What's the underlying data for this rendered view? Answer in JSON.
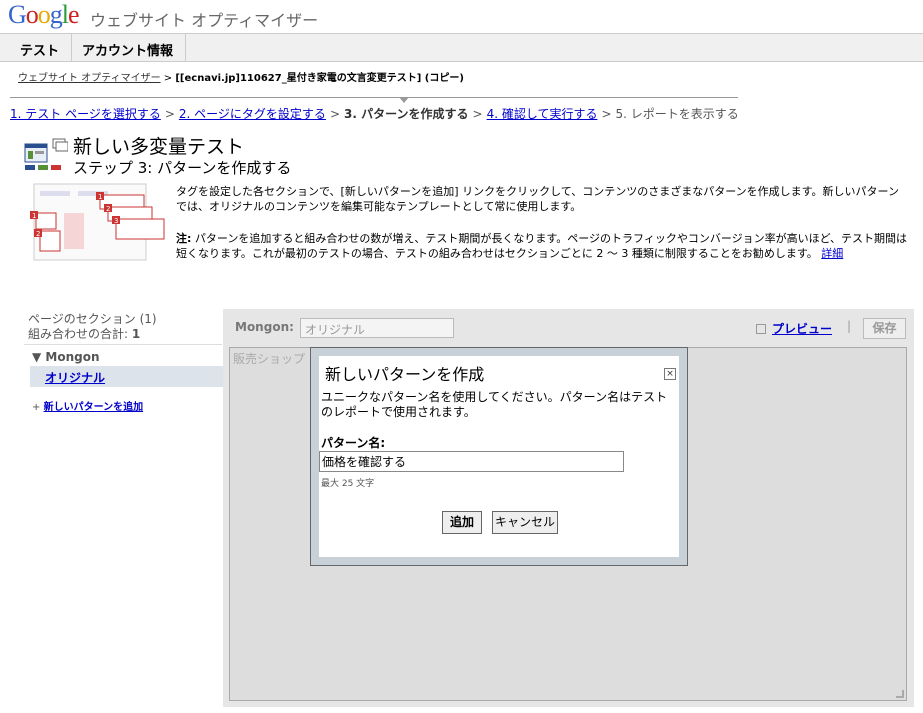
{
  "header": {
    "logo_text": "Google",
    "product_name": "ウェブサイト オプティマイザー"
  },
  "tabs": [
    {
      "label": "テスト"
    },
    {
      "label": "アカウント情報"
    }
  ],
  "breadcrumb": {
    "root": "ウェブサイト オプティマイザー",
    "separator": ">",
    "current": "[[ecnavi.jp]110627_星付き家電の文言変更テスト] (コピー)"
  },
  "steps": [
    {
      "label": "1. テスト ページを選択する",
      "state": "link"
    },
    {
      "label": "2. ページにタグを設定する",
      "state": "link"
    },
    {
      "label": "3. パターンを作成する",
      "state": "current"
    },
    {
      "label": "4. 確認して実行する",
      "state": "link"
    },
    {
      "label": "5. レポートを表示する",
      "state": "disabled"
    }
  ],
  "page": {
    "title": "新しい多変量テスト",
    "subtitle": "ステップ 3: パターンを作成する",
    "desc1": "タグを設定した各セクションで、[新しいパターンを追加] リンクをクリックして、コンテンツのさまざまなパターンを作成します。新しいパターンでは、オリジナルのコンテンツを編集可能なテンプレートとして常に使用します。",
    "note_label": "注:",
    "note_text": "パターンを追加すると組み合わせの数が増え、テスト期間が長くなります。ページのトラフィックやコンバージョン率が高いほど、テスト期間は短くなります。これが最初のテストの場合、テストの組み合わせはセクションごとに 2 〜 3 種類に制限することをお勧めします。",
    "note_link": "詳細"
  },
  "sidebar": {
    "sections_title": "ページのセクション (1)",
    "combo_label": "組み合わせの合計:",
    "combo_value": "1",
    "section_name": "Mongon",
    "variation": "オリジナル",
    "add_prefix": "+",
    "add_link": "新しいパターンを追加"
  },
  "editor": {
    "section_label": "Mongon:",
    "name_value": "オリジナル",
    "preview_link": "プレビュー",
    "separator": "|",
    "save_label": "保存",
    "content_text": "販売ショップ"
  },
  "modal": {
    "title": "新しいパターンを作成",
    "close_glyph": "×",
    "description": "ユニークなパターン名を使用してください。パターン名はテストのレポートで使用されます。",
    "name_label": "パターン名:",
    "name_value": "価格を確認する",
    "hint": "最大 25 文字",
    "add_label": "追加",
    "cancel_label": "キャンセル"
  },
  "colors": {
    "link": "#0000cc",
    "logo_blue": "#3366cc",
    "logo_red": "#cc2222",
    "logo_yellow": "#e6a900",
    "logo_green": "#2b9b3a",
    "modal_frame": "#c8d0d8",
    "editor_bg": "#e6e6e6"
  }
}
